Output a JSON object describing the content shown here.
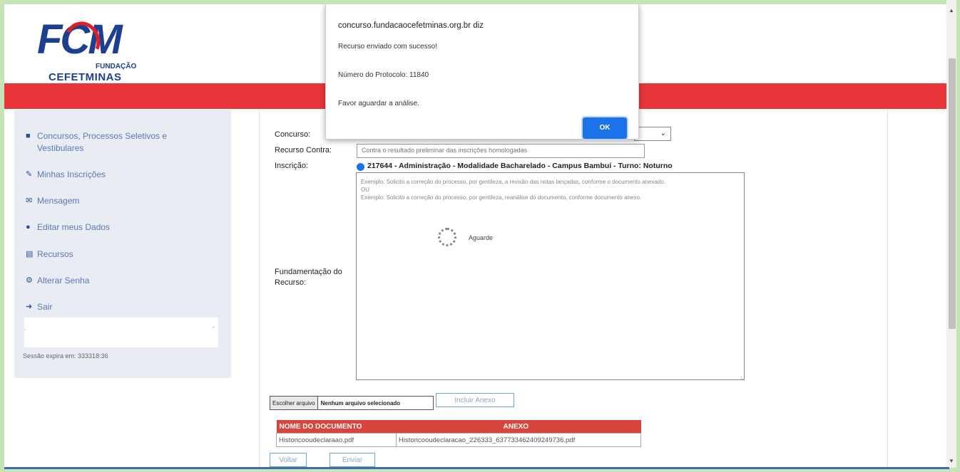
{
  "logo": {
    "main": "FCM",
    "line1": "FUNDAÇÃO",
    "line2": "CEFETMINAS"
  },
  "sidebar": {
    "items": [
      {
        "label": "Concursos, Processos Seletivos e Vestibulares",
        "icon": "folder-icon"
      },
      {
        "label": "Minhas Inscrições",
        "icon": "edit-icon"
      },
      {
        "label": "Mensagem",
        "icon": "envelope-icon"
      },
      {
        "label": "Editar meus Dados",
        "icon": "user-icon"
      },
      {
        "label": "Recursos",
        "icon": "print-icon"
      },
      {
        "label": "Alterar Senha",
        "icon": "gear-icon"
      },
      {
        "label": "Sair",
        "icon": "sign-out-icon"
      }
    ],
    "session_text": "Sessão expira em: 333318:36"
  },
  "form": {
    "concurso_label": "Concurso:",
    "recurso_label": "Recurso Contra:",
    "recurso_value": "Contra o resultado preliminar das inscrições homologadas",
    "inscricao_label": "Inscrição:",
    "inscricao_value": "217644 - Administração - Modalidade Bacharelado - Campus Bambuí - Turno: Noturno",
    "fundamentacao_label": "Fundamentação do Recurso:",
    "textarea_placeholder": "Exemplo: Solicito a correção do processo, por gentileza, a revisão das notas lançadas, conforme o documento anexado.\nOU\nExemplo: Solicito a correção do processo, por gentileza, reanálise do documento, conforme documento anexo.",
    "loading_text": "Aguarde",
    "file_button": "Escolher arquivo",
    "file_status": "Nenhum arquivo selecionado",
    "add_attachment": "Incluir Anexo"
  },
  "documents": {
    "headers": [
      "NOME DO DOCUMENTO",
      "ANEXO"
    ],
    "rows": [
      [
        "Historicooudeclaraao.pdf",
        "Historicooudeclaracao_226333_637733462409249736.pdf"
      ]
    ]
  },
  "buttons": {
    "back": "Voltar",
    "send": "Enviar"
  },
  "dialog": {
    "title": "concurso.fundacaocefetminas.org.br diz",
    "line1": "Recurso enviado com sucesso!",
    "line2": "Número do Protocolo: 11840",
    "line3": "Favor aguardar a análise.",
    "ok": "OK"
  },
  "colors": {
    "brand_blue": "#1d3f8f",
    "brand_red": "#e8353a",
    "dialog_button": "#1a73e8"
  }
}
